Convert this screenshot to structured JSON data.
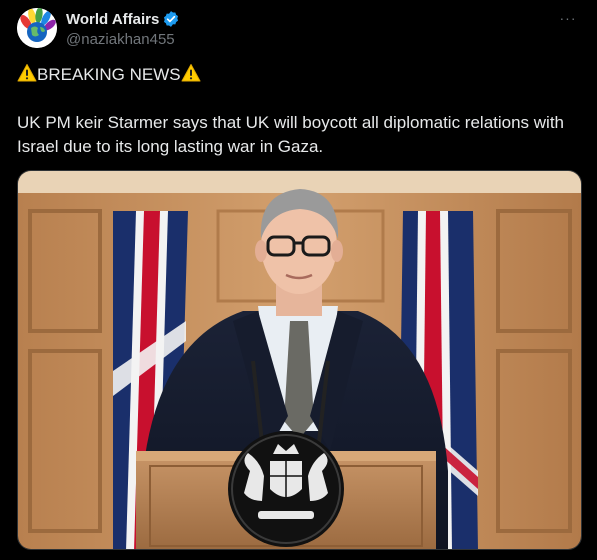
{
  "author": {
    "display_name": "World Affairs",
    "handle": "@naziakhan455",
    "verified": true,
    "avatar_icon": "globe-hands-logo",
    "verified_icon": "verified-badge-icon"
  },
  "post": {
    "headline": "BREAKING NEWS",
    "headline_icon": "warning-icon",
    "body": "UK PM keir Starmer says that UK will boycott all diplomatic relations with Israel due to its long lasting war in Gaza.",
    "more_label": "···"
  },
  "media": {
    "description_icon": "press-conference-photo"
  },
  "colors": {
    "background": "#000000",
    "text": "#e7e9ea",
    "secondary": "#71767b",
    "verified": "#1d9bf0",
    "warning": "#ffcc00"
  }
}
